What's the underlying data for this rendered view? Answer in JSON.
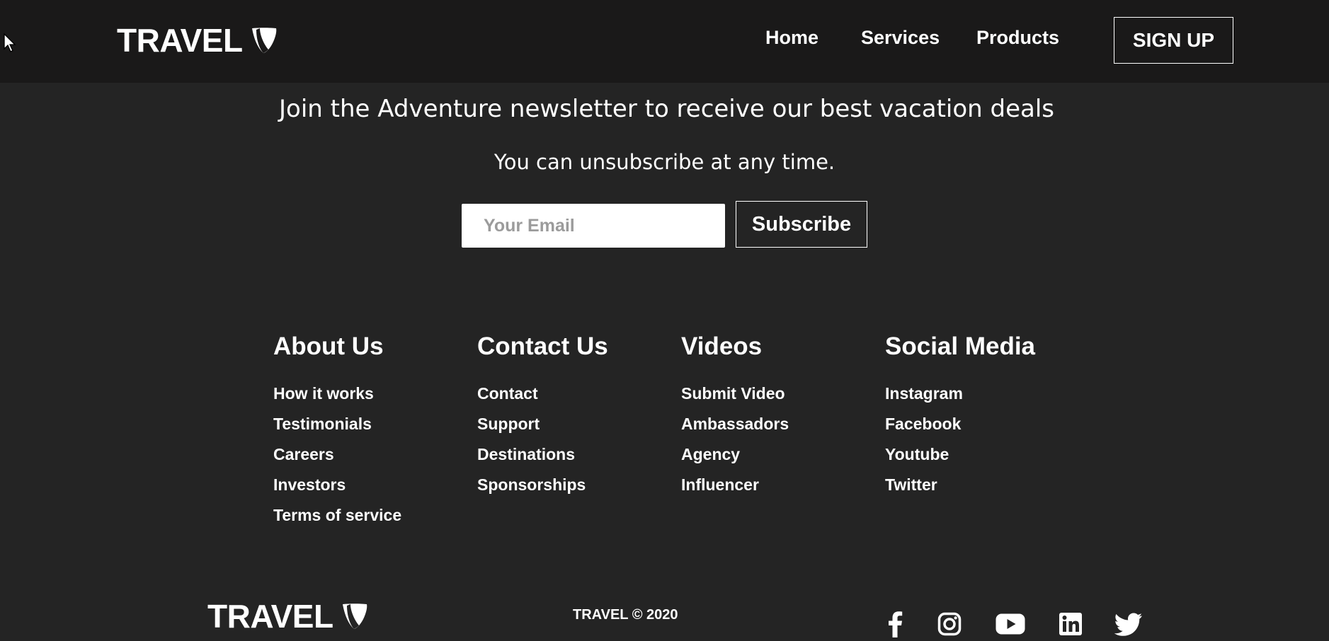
{
  "header": {
    "logo_text": "TRAVEL",
    "nav": [
      {
        "label": "Home"
      },
      {
        "label": "Services"
      },
      {
        "label": "Products"
      }
    ],
    "signup_label": "SIGN UP"
  },
  "newsletter": {
    "title": "Join the Adventure newsletter to receive our best vacation deals",
    "subtitle": "You can unsubscribe at any time.",
    "email_placeholder": "Your Email",
    "email_value": "",
    "subscribe_label": "Subscribe"
  },
  "footer": {
    "columns": [
      {
        "heading": "About Us",
        "links": [
          "How it works",
          "Testimonials",
          "Careers",
          "Investors",
          "Terms of service"
        ]
      },
      {
        "heading": "Contact Us",
        "links": [
          "Contact",
          "Support",
          "Destinations",
          "Sponsorships"
        ]
      },
      {
        "heading": "Videos",
        "links": [
          "Submit Video",
          "Ambassadors",
          "Agency",
          "Influencer"
        ]
      },
      {
        "heading": "Social Media",
        "links": [
          "Instagram",
          "Facebook",
          "Youtube",
          "Twitter"
        ]
      }
    ],
    "logo_text": "TRAVEL",
    "copyright": "TRAVEL © 2020",
    "social_icons": [
      "facebook-icon",
      "instagram-icon",
      "youtube-icon",
      "linkedin-icon",
      "twitter-icon"
    ]
  },
  "colors": {
    "navbar_bg": "#1a1919",
    "page_bg": "#242424",
    "text": "#ffffff",
    "placeholder": "#9b9b9b"
  }
}
